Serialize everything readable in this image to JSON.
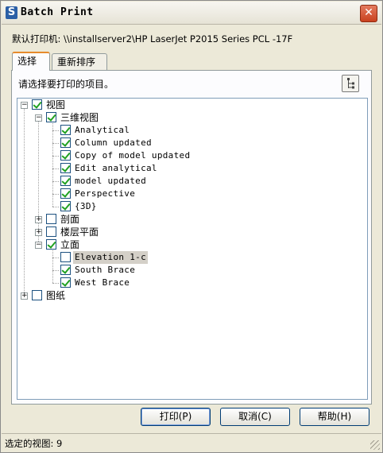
{
  "window": {
    "title": "Batch Print",
    "app_icon_glyph": "S",
    "close_glyph": "✕"
  },
  "printer": {
    "text": "默认打印机: \\\\installserver2\\HP LaserJet P2015 Series PCL -17F"
  },
  "tabs": [
    {
      "label": "选择",
      "active": true
    },
    {
      "label": "重新排序",
      "active": false
    }
  ],
  "instruction": "请选择要打印的项目。",
  "tree": {
    "root_views": {
      "label": "视图",
      "checked": true,
      "expanded": true
    },
    "3d_views": {
      "label": "三维视图",
      "checked": true,
      "expanded": true
    },
    "items_3d": [
      {
        "label": "Analytical",
        "checked": true
      },
      {
        "label": "Column updated",
        "checked": true
      },
      {
        "label": "Copy of model updated",
        "checked": true
      },
      {
        "label": "Edit analytical",
        "checked": true
      },
      {
        "label": "model updated",
        "checked": true
      },
      {
        "label": "Perspective",
        "checked": true
      },
      {
        "label": "{3D}",
        "checked": true
      }
    ],
    "sections": {
      "label": "剖面",
      "checked": false,
      "expanded": false
    },
    "floor_plans": {
      "label": "楼层平面",
      "checked": false,
      "expanded": false
    },
    "elevations": {
      "label": "立面",
      "checked": true,
      "expanded": true
    },
    "items_elev": [
      {
        "label": "Elevation 1-c",
        "checked": false,
        "selected": true
      },
      {
        "label": "South Brace",
        "checked": true
      },
      {
        "label": "West Brace",
        "checked": true
      }
    ],
    "sheets": {
      "label": "图纸",
      "checked": false,
      "expanded": false
    }
  },
  "buttons": {
    "print": "打印(P)",
    "cancel": "取消(C)",
    "help": "帮助(H)"
  },
  "status": {
    "text": "选定的视图: 9"
  },
  "colors": {
    "check": "#21a121",
    "close_button": "#c9411e",
    "tab_accent": "#e68b2c"
  }
}
